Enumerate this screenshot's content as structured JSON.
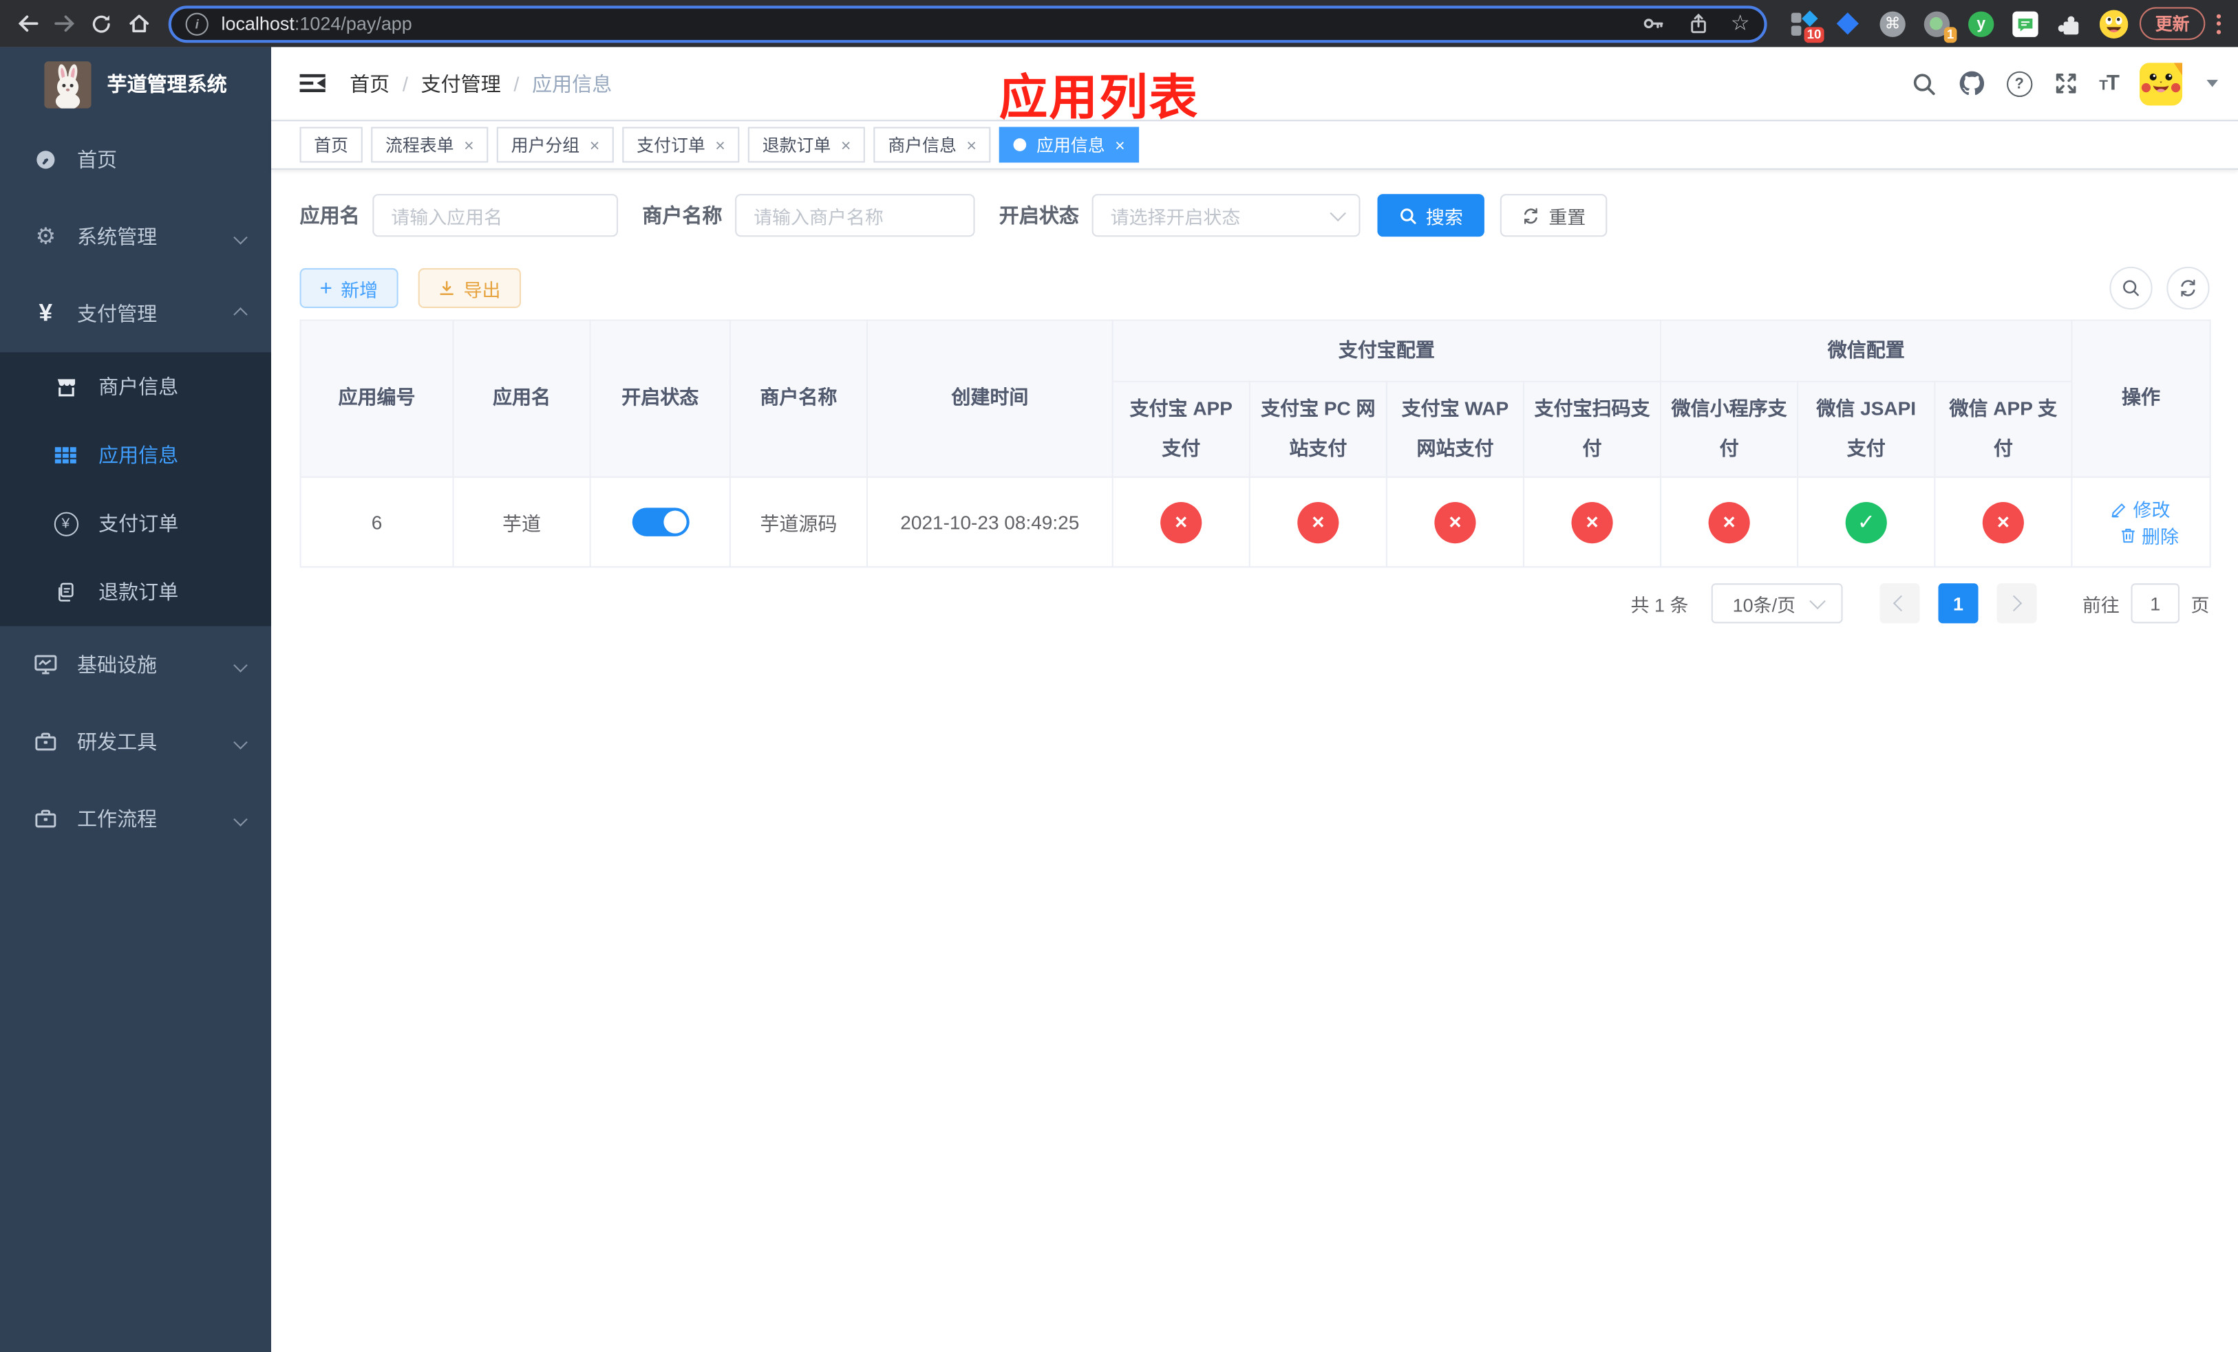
{
  "browser": {
    "url_host": "localhost",
    "url_rest": ":1024/pay/app",
    "update_label": "更新",
    "ext_badge_10": "10",
    "ext_badge_1": "1",
    "ext_letter_y": "y"
  },
  "sidebar": {
    "title": "芋道管理系统",
    "menu": [
      {
        "label": "首页"
      },
      {
        "label": "系统管理"
      },
      {
        "label": "支付管理"
      },
      {
        "label": "基础设施"
      },
      {
        "label": "研发工具"
      },
      {
        "label": "工作流程"
      }
    ],
    "submenu": [
      {
        "label": "商户信息"
      },
      {
        "label": "应用信息"
      },
      {
        "label": "支付订单"
      },
      {
        "label": "退款订单"
      }
    ]
  },
  "header": {
    "breadcrumb": [
      "首页",
      "支付管理",
      "应用信息"
    ],
    "overlay_title": "应用列表"
  },
  "tabs": [
    {
      "label": "首页"
    },
    {
      "label": "流程表单"
    },
    {
      "label": "用户分组"
    },
    {
      "label": "支付订单"
    },
    {
      "label": "退款订单"
    },
    {
      "label": "商户信息"
    },
    {
      "label": "应用信息"
    }
  ],
  "filters": {
    "app_name_label": "应用名",
    "app_name_placeholder": "请输入应用名",
    "merchant_label": "商户名称",
    "merchant_placeholder": "请输入商户名称",
    "status_label": "开启状态",
    "status_placeholder": "请选择开启状态",
    "search_label": "搜索",
    "reset_label": "重置"
  },
  "toolbar": {
    "add_label": "新增",
    "export_label": "导出"
  },
  "table": {
    "group_alipay": "支付宝配置",
    "group_wechat": "微信配置",
    "col_id": "应用编号",
    "col_name": "应用名",
    "col_status": "开启状态",
    "col_merchant": "商户名称",
    "col_created": "创建时间",
    "col_alipay_app": "支付宝 APP 支付",
    "col_alipay_pc": "支付宝 PC 网站支付",
    "col_alipay_wap": "支付宝 WAP 网站支付",
    "col_alipay_qr": "支付宝扫码支付",
    "col_wx_mini": "微信小程序支付",
    "col_wx_jsapi": "微信 JSAPI 支付",
    "col_wx_app": "微信 APP 支付",
    "col_actions": "操作",
    "row": {
      "id": "6",
      "name": "芋道",
      "enabled": true,
      "merchant": "芋道源码",
      "created": "2021-10-23 08:49:25",
      "statuses": [
        "no",
        "no",
        "no",
        "no",
        "no",
        "yes",
        "no"
      ],
      "edit_label": "修改",
      "delete_label": "删除"
    }
  },
  "pagination": {
    "total": "共 1 条",
    "page_size": "10条/页",
    "current_page": "1",
    "goto_prefix": "前往",
    "goto_value": "1",
    "goto_suffix": "页"
  },
  "colors": {
    "accent_blue": "#409eff",
    "solid_blue": "#1f8bf5",
    "danger_red": "#f44c4c",
    "success_green": "#1ec269",
    "warning_orange": "#e6a23c",
    "sidebar_bg": "#304156",
    "submenu_bg": "#1f2d3d",
    "overlay_red": "#fe2115",
    "chrome_update": "#ee9088"
  },
  "icons": {
    "back": "arrow-left",
    "forward": "arrow-right",
    "reload": "circular-arrow",
    "home": "house",
    "info": "i-circle",
    "key": "key",
    "share": "box-up-arrow",
    "bookmark": "star",
    "extensions": "puzzle-piece",
    "search": "magnifier",
    "github": "octocat",
    "help": "question-circle",
    "fullscreen": "expand-arrows",
    "font_size": "tT",
    "caret": "triangle-down",
    "close": "×",
    "check": "✓",
    "cross": "×",
    "plus": "+",
    "download": "arrow-to-line",
    "refresh": "circular-arrows",
    "edit": "pencil",
    "delete": "trash"
  }
}
